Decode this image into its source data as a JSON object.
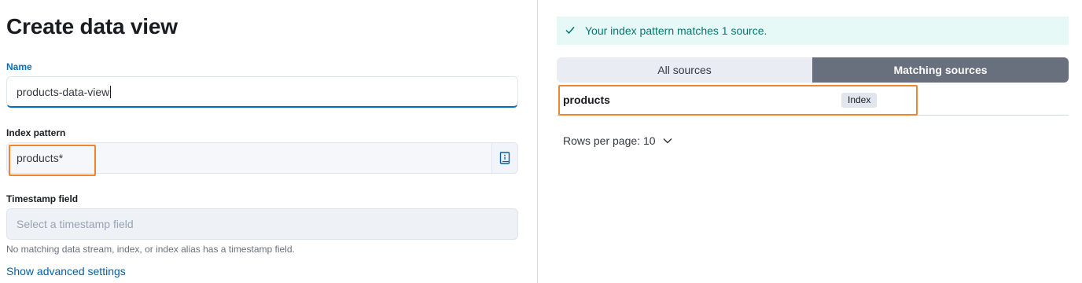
{
  "form": {
    "title": "Create data view",
    "name": {
      "label": "Name",
      "value": "products-data-view"
    },
    "index_pattern": {
      "label": "Index pattern",
      "value": "products*"
    },
    "timestamp": {
      "label": "Timestamp field",
      "placeholder": "Select a timestamp field",
      "help": "No matching data stream, index, or index alias has a timestamp field."
    },
    "advanced_link": "Show advanced settings"
  },
  "sources": {
    "callout": "Your index pattern matches 1 source.",
    "tabs": [
      {
        "label": "All sources",
        "selected": false
      },
      {
        "label": "Matching sources",
        "selected": true
      }
    ],
    "rows": [
      {
        "name": "products",
        "type": "Index"
      }
    ],
    "rows_per_page": "Rows per page: 10"
  },
  "icons": {
    "callout": "check-icon",
    "index_append": "book-info-icon",
    "rows_per_page": "chevron-down-icon"
  },
  "colors": {
    "accent": "#0071c2",
    "link": "#0061a6",
    "success_bg": "#e6f9f7",
    "success_text": "#007871",
    "selected_tab": "#69707d",
    "highlight": "#f0852d"
  }
}
